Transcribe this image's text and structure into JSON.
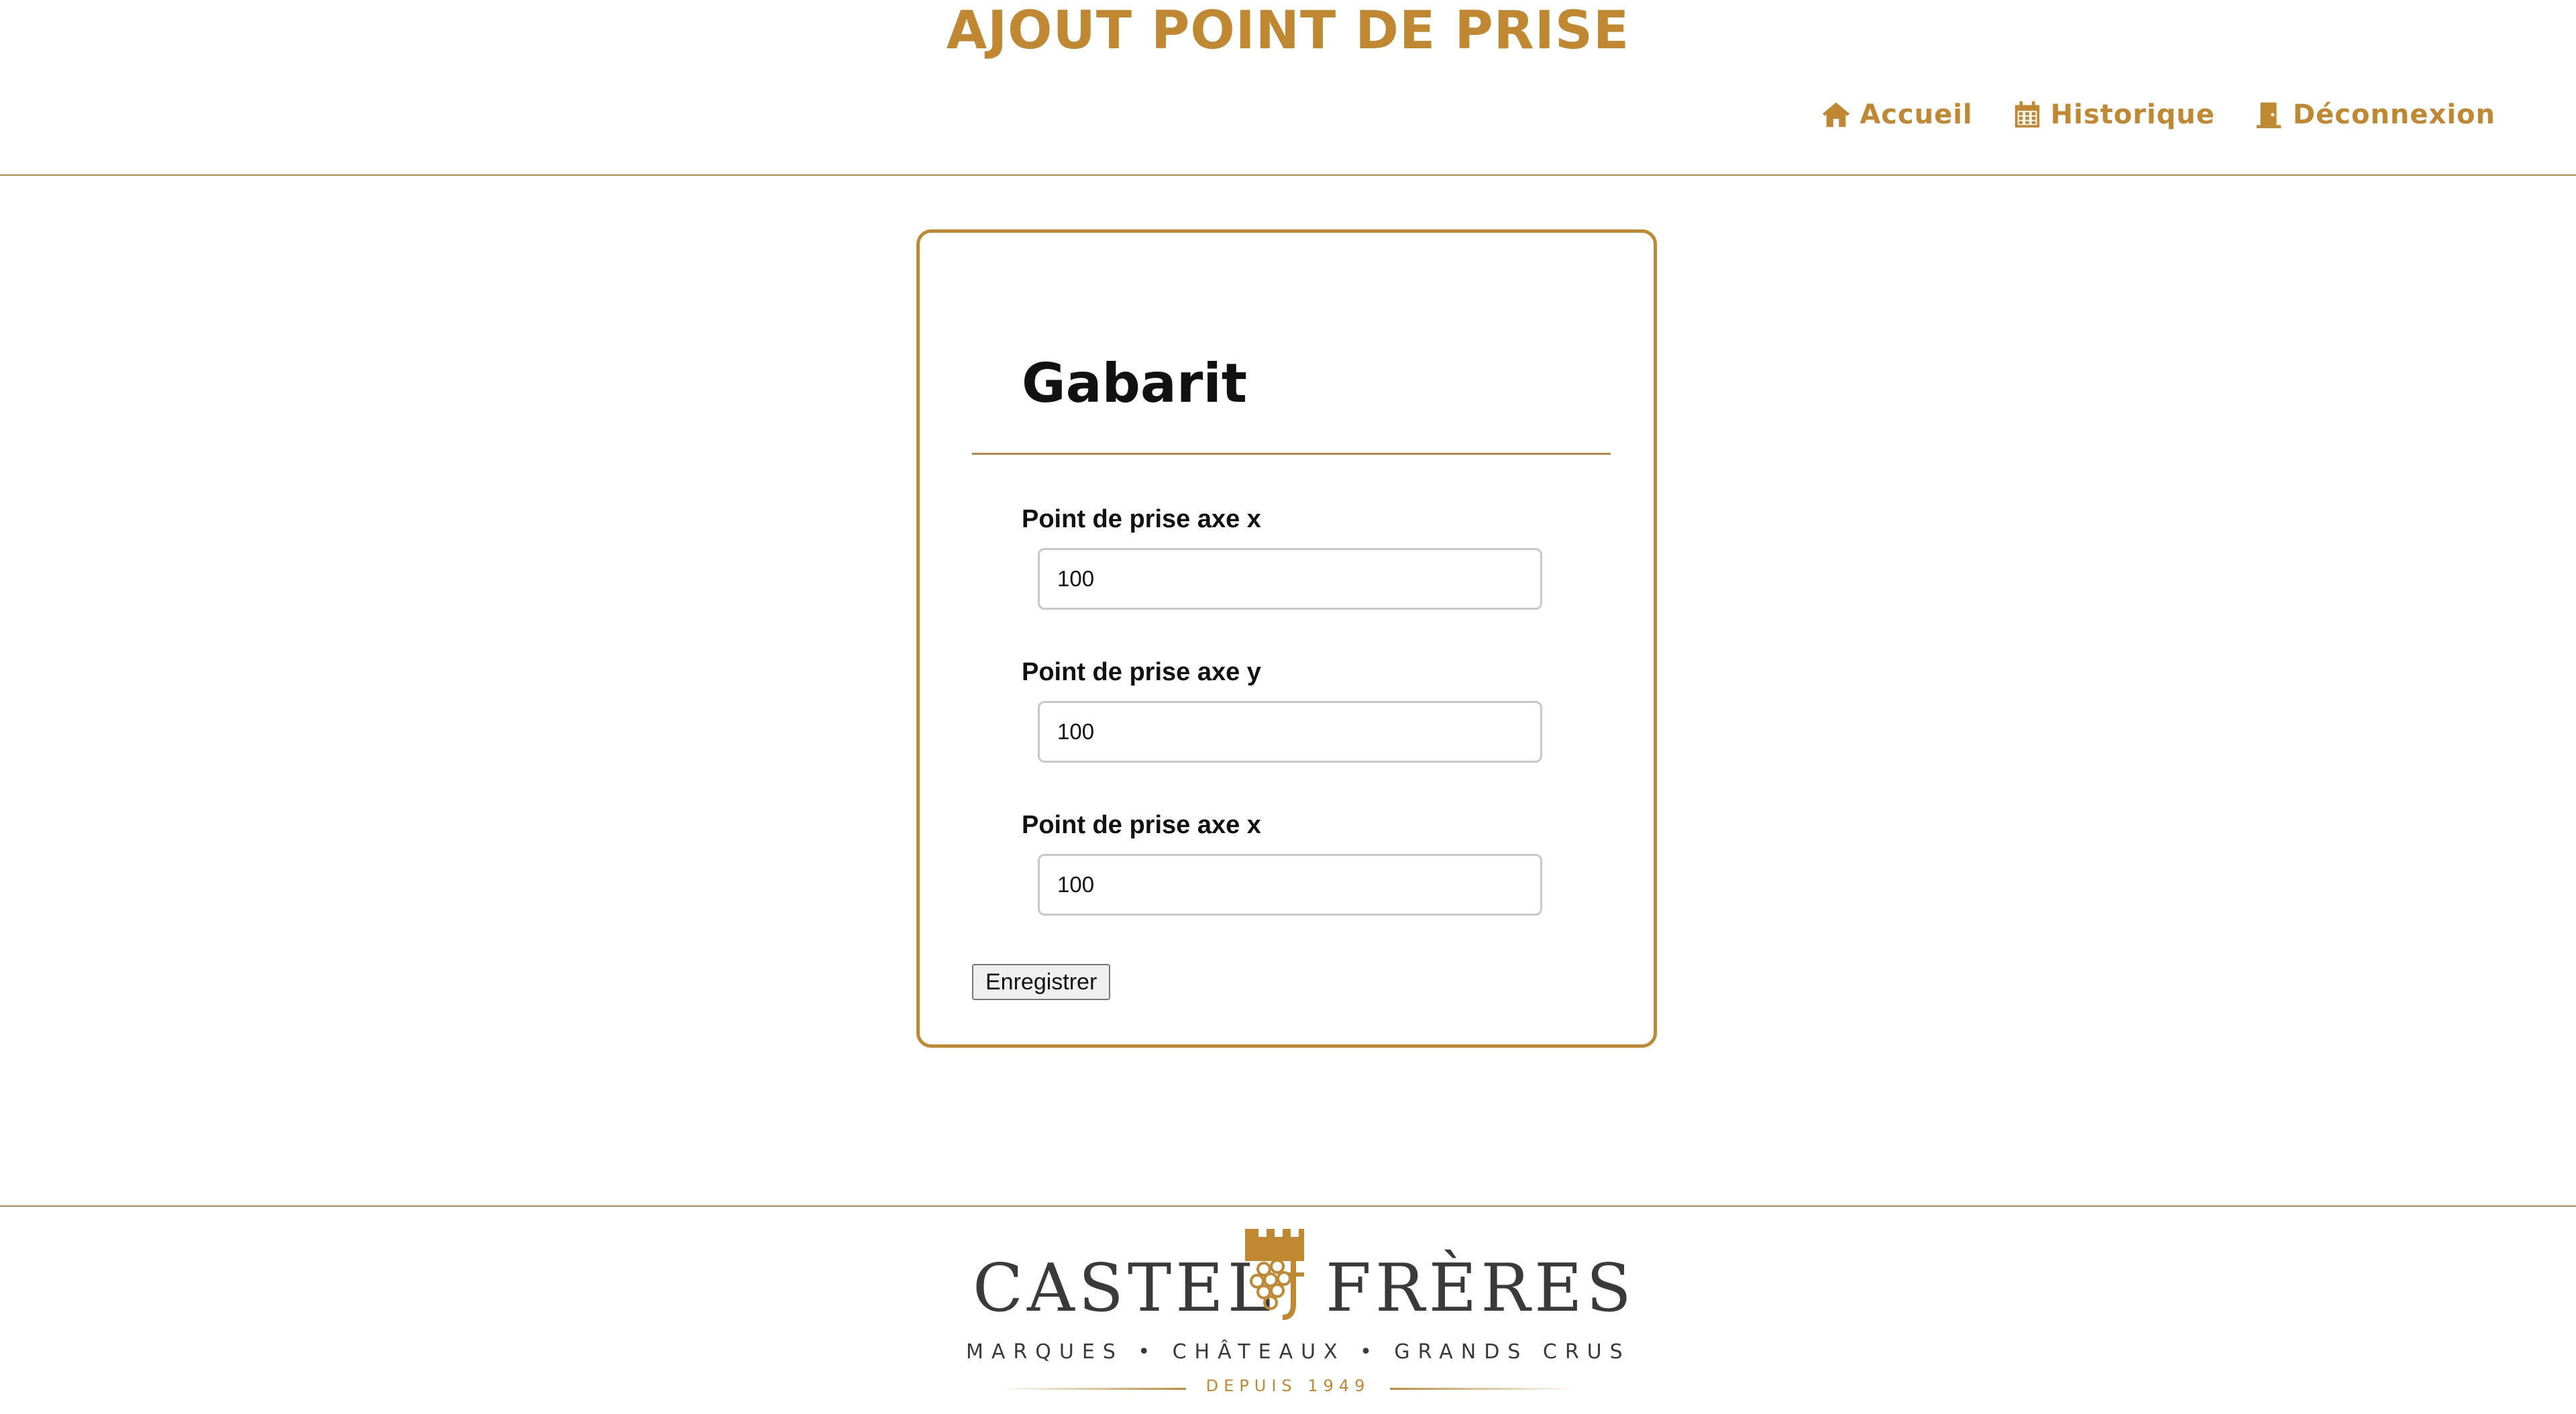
{
  "header": {
    "title": "AJOUT POINT DE PRISE",
    "nav": [
      {
        "label": "Accueil",
        "icon": "home-icon"
      },
      {
        "label": "Historique",
        "icon": "calendar-icon"
      },
      {
        "label": "Déconnexion",
        "icon": "door-icon"
      }
    ]
  },
  "form": {
    "title": "Gabarit",
    "fields": [
      {
        "label": "Point de prise axe x",
        "value": "100"
      },
      {
        "label": "Point de prise axe y",
        "value": "100"
      },
      {
        "label": "Point de prise axe x",
        "value": "100"
      }
    ],
    "submit_label": "Enregistrer"
  },
  "footer": {
    "logo": {
      "word_left": "CASTEL",
      "word_right": "FRÈRES",
      "tagline": "MARQUES • CHÂTEAUX • GRANDS CRUS",
      "since": "DEPUIS 1949"
    }
  },
  "colors": {
    "accent": "#c08830",
    "divider": "#b68a45",
    "text": "#111111"
  }
}
